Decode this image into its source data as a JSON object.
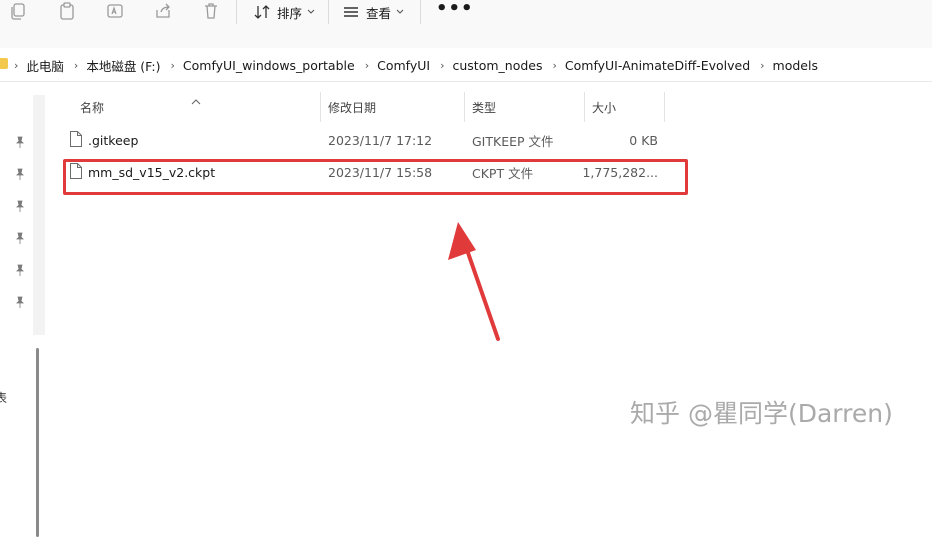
{
  "toolbar": {
    "icons": [
      "copy-icon",
      "paste-icon",
      "rename-icon",
      "share-icon",
      "delete-icon"
    ],
    "sort_label": "排序",
    "view_label": "查看",
    "more_label": "•••"
  },
  "breadcrumb": {
    "items": [
      "此电脑",
      "本地磁盘 (F:)",
      "ComfyUI_windows_portable",
      "ComfyUI",
      "custom_nodes",
      "ComfyUI-AnimateDiff-Evolved",
      "models"
    ],
    "separator": "›"
  },
  "nav": {
    "pins": 6,
    "edge_char": "表"
  },
  "columns": {
    "name": "名称",
    "modified": "修改日期",
    "type": "类型",
    "size": "大小"
  },
  "files": [
    {
      "name": ".gitkeep",
      "modified": "2023/11/7 17:12",
      "type": "GITKEEP 文件",
      "size": "0 KB"
    },
    {
      "name": "mm_sd_v15_v2.ckpt",
      "modified": "2023/11/7 15:58",
      "type": "CKPT 文件",
      "size": "1,775,282..."
    }
  ],
  "highlight_color": "#e03a3a",
  "watermark": "知乎 @瞿同学(Darren)"
}
